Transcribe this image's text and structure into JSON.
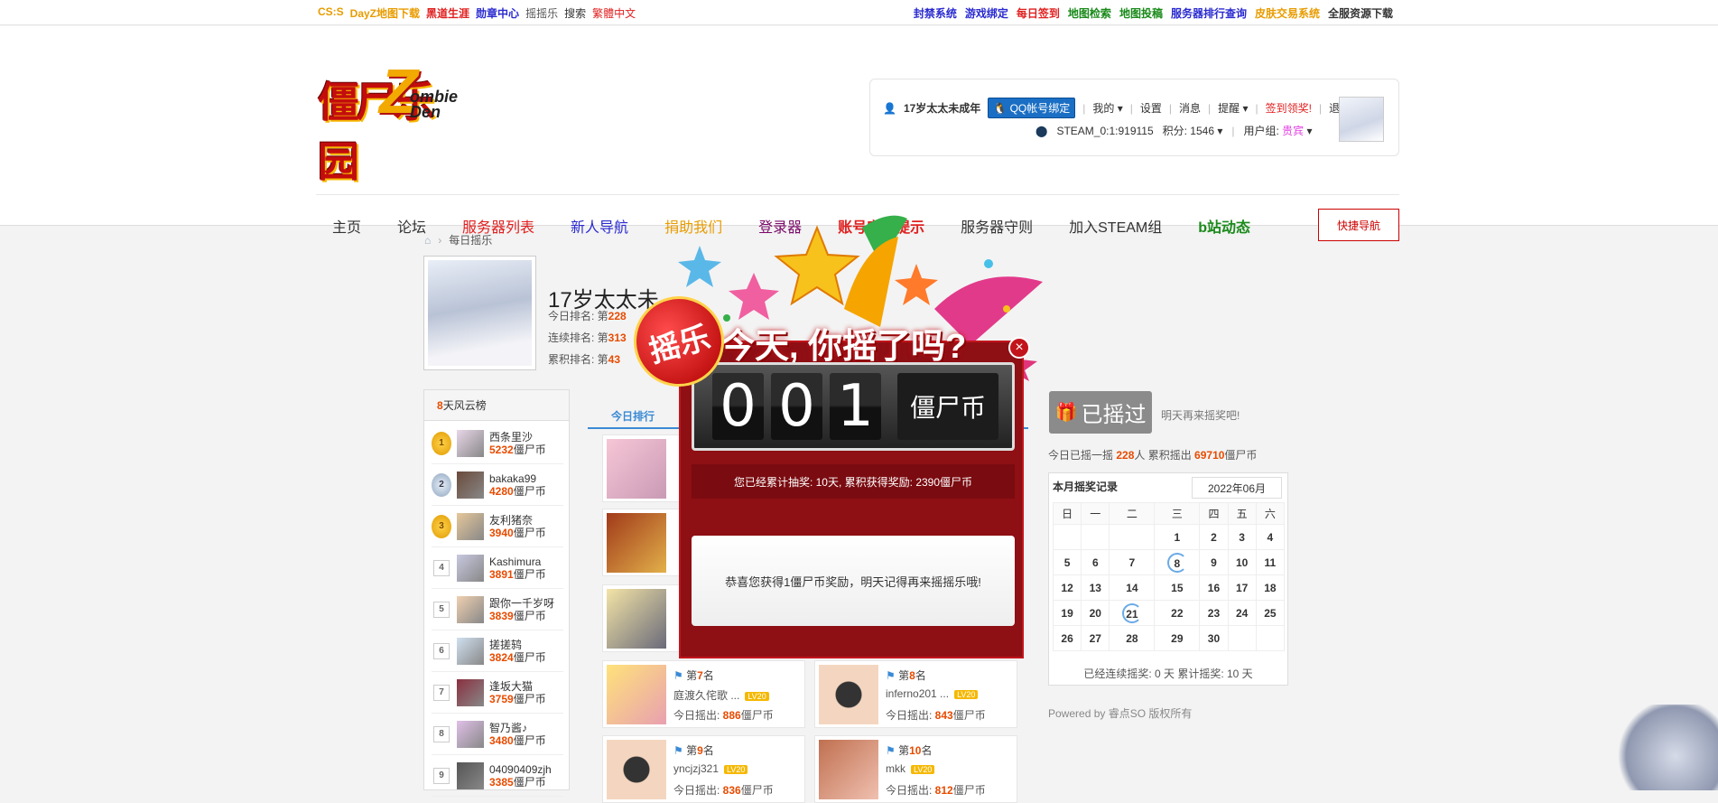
{
  "topbar": {
    "left": [
      {
        "label": "CS:S",
        "color": "#e89c00"
      },
      {
        "label": "DayZ地图下载",
        "color": "#e89c00"
      },
      {
        "label": "黑道生涯",
        "color": "#e02020"
      },
      {
        "label": "勋章中心",
        "color": "#2a2ad0"
      },
      {
        "label": "摇摇乐",
        "color": "#555555"
      },
      {
        "label": "搜索",
        "color": "#333333"
      },
      {
        "label": "繁體中文",
        "color": "#e02020"
      }
    ],
    "right": [
      {
        "label": "封禁系统",
        "color": "#2a2ad0"
      },
      {
        "label": "游戏绑定",
        "color": "#2a2ad0"
      },
      {
        "label": "每日签到",
        "color": "#e02020"
      },
      {
        "label": "地图检索",
        "color": "#1a8a1a"
      },
      {
        "label": "地图投稿",
        "color": "#1a8a1a"
      },
      {
        "label": "服务器排行查询",
        "color": "#2a2ad0"
      },
      {
        "label": "皮肤交易系统",
        "color": "#e89c00"
      },
      {
        "label": "全服资源下载",
        "color": "#333333"
      }
    ]
  },
  "logo": {
    "zh": "僵尸乐园",
    "en1": "ombie",
    "en2": "Den",
    "z": "Z"
  },
  "user": {
    "name": "17岁太太未成年",
    "qq_btn": "QQ帐号绑定",
    "mine": "我的",
    "settings": "设置",
    "messages": "消息",
    "remind": "提醒",
    "sign": "签到领奖!",
    "logout": "退出",
    "steam": "STEAM_0:1:919115",
    "points": "积分: 1546",
    "group_label": "用户组:",
    "group": "贵宾"
  },
  "nav": {
    "items": [
      {
        "label": "主页",
        "color": "#333"
      },
      {
        "label": "论坛",
        "color": "#333"
      },
      {
        "label": "服务器列表",
        "color": "#e02020"
      },
      {
        "label": "新人导航",
        "color": "#2a2ad0"
      },
      {
        "label": "捐助我们",
        "color": "#e89c00"
      },
      {
        "label": "登录器",
        "color": "#7a0a6a"
      },
      {
        "label": "账号安全提示",
        "color": "#e02020"
      },
      {
        "label": "服务器守则",
        "color": "#333"
      },
      {
        "label": "加入STEAM组",
        "color": "#333"
      },
      {
        "label": "b站动态",
        "color": "#1a8a1a"
      }
    ],
    "quick": "快捷导航"
  },
  "breadcrumb": "每日摇乐",
  "profile": {
    "name": "17岁太太未",
    "rank_today": "今日排名: 第",
    "rank_today_v": "228",
    "rank_cont": "连续排名: 第",
    "rank_cont_v": "313",
    "rank_total": "累积排名: 第",
    "rank_total_v": "43"
  },
  "leaderboard": {
    "title_num": "8",
    "title": "天风云榜",
    "unit": "僵尸币",
    "items": [
      {
        "rank": "1",
        "name": "西条里沙",
        "coins": "5232"
      },
      {
        "rank": "2",
        "name": "bakaka99",
        "coins": "4280"
      },
      {
        "rank": "3",
        "name": "友利猪奈",
        "coins": "3940"
      },
      {
        "rank": "4",
        "name": "Kashimura",
        "coins": "3891"
      },
      {
        "rank": "5",
        "name": "跟你一千岁呀",
        "coins": "3839"
      },
      {
        "rank": "6",
        "name": "搓搓鸫",
        "coins": "3824"
      },
      {
        "rank": "7",
        "name": "逢坂大猫",
        "coins": "3759"
      },
      {
        "rank": "8",
        "name": "智乃酱♪",
        "coins": "3480"
      },
      {
        "rank": "9",
        "name": "04090409zjh",
        "coins": "3385"
      }
    ]
  },
  "tabs": {
    "today": "今日排行"
  },
  "cards": [
    {
      "rank": "7",
      "name": "庭渡久侘歌 ...",
      "amount": "886",
      "lv": "LV20"
    },
    {
      "rank": "8",
      "name": "inferno201 ...",
      "amount": "843",
      "lv": "LV20"
    },
    {
      "rank": "9",
      "name": "yncjzj321",
      "amount": "836",
      "lv": "LV20"
    },
    {
      "rank": "10",
      "name": "mkk",
      "amount": "812",
      "lv": "LV20"
    }
  ],
  "card_labels": {
    "prefix": "第",
    "suffix": "名",
    "today": "今日摇出: ",
    "unit": "僵尸币"
  },
  "shake": {
    "button": "已摇过",
    "next": "明天再来摇奖吧!",
    "stat_pre": "今日已摇一摇 ",
    "count": "228",
    "stat_mid": "人 累积摇出 ",
    "total": "69710",
    "stat_unit": "僵尸币"
  },
  "calendar": {
    "title": "本月摇奖记录",
    "month": "2022年06月",
    "weekdays": [
      "日",
      "一",
      "二",
      "三",
      "四",
      "五",
      "六"
    ],
    "rows": [
      [
        "",
        "",
        "",
        "1",
        "2",
        "3",
        "4"
      ],
      [
        "5",
        "6",
        "7",
        "8",
        "9",
        "10",
        "11"
      ],
      [
        "12",
        "13",
        "14",
        "15",
        "16",
        "17",
        "18"
      ],
      [
        "19",
        "20",
        "21",
        "22",
        "23",
        "24",
        "25"
      ],
      [
        "26",
        "27",
        "28",
        "29",
        "30",
        "",
        ""
      ]
    ],
    "marked": [
      "8",
      "21"
    ],
    "footer": "已经连续摇奖:  0 天 累计摇奖:  10 天"
  },
  "powered": "Powered by 睿点SO 版权所有",
  "popup": {
    "badge": "摇乐",
    "title": "今天, 你摇了吗?",
    "digits": [
      "0",
      "0",
      "1"
    ],
    "unit": "僵尸币",
    "cumulative": "您已经累计抽奖: 10天, 累积获得奖励: 2390僵尸币",
    "message": "恭喜您获得1僵尸币奖励，明天记得再来摇摇乐哦!",
    "close": "×"
  }
}
